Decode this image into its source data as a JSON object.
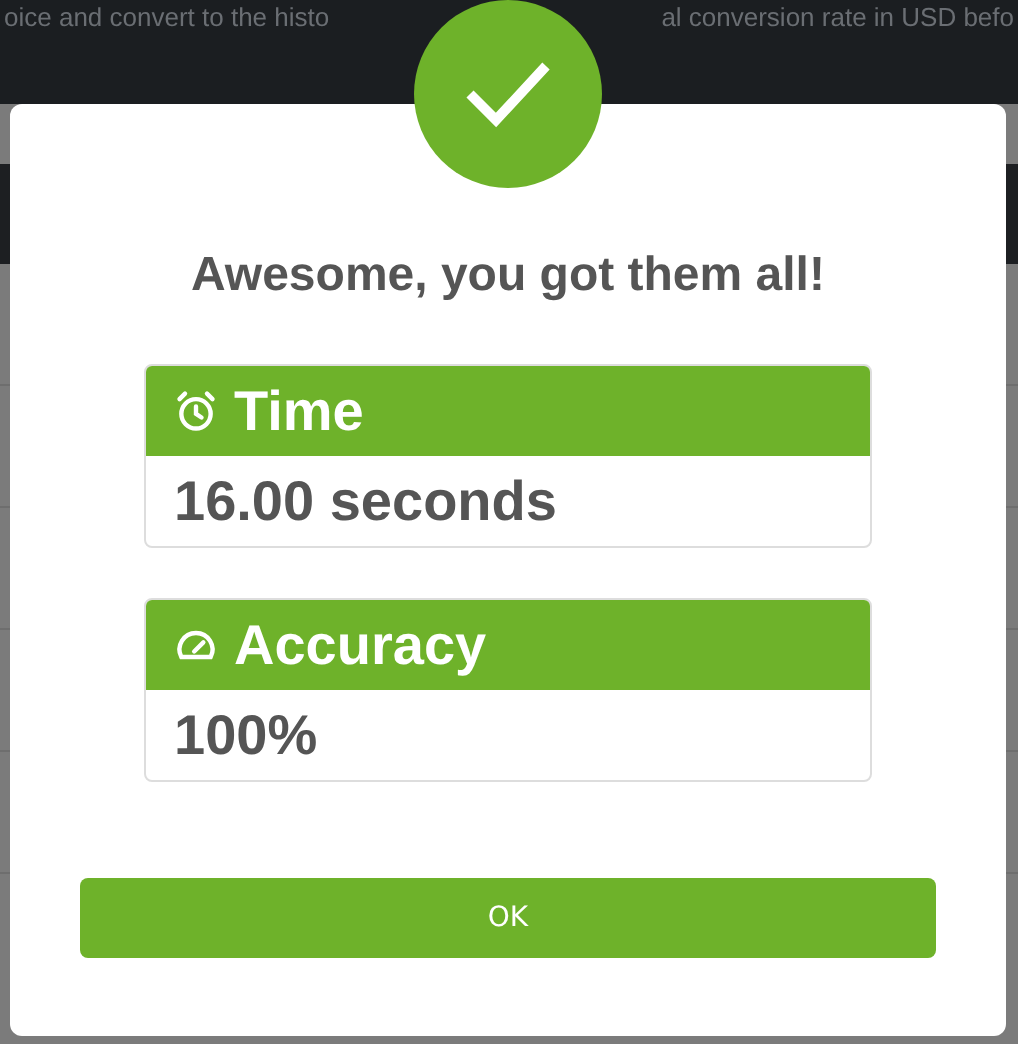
{
  "background": {
    "text_left": "oice and convert to the histo",
    "text_right": "al conversion rate in USD befo"
  },
  "dialog": {
    "heading": "Awesome, you got them all!",
    "stats": [
      {
        "kind": "time",
        "label": "Time",
        "value": "16.00 seconds"
      },
      {
        "kind": "accuracy",
        "label": "Accuracy",
        "value": "100%"
      }
    ],
    "button": "OK"
  }
}
